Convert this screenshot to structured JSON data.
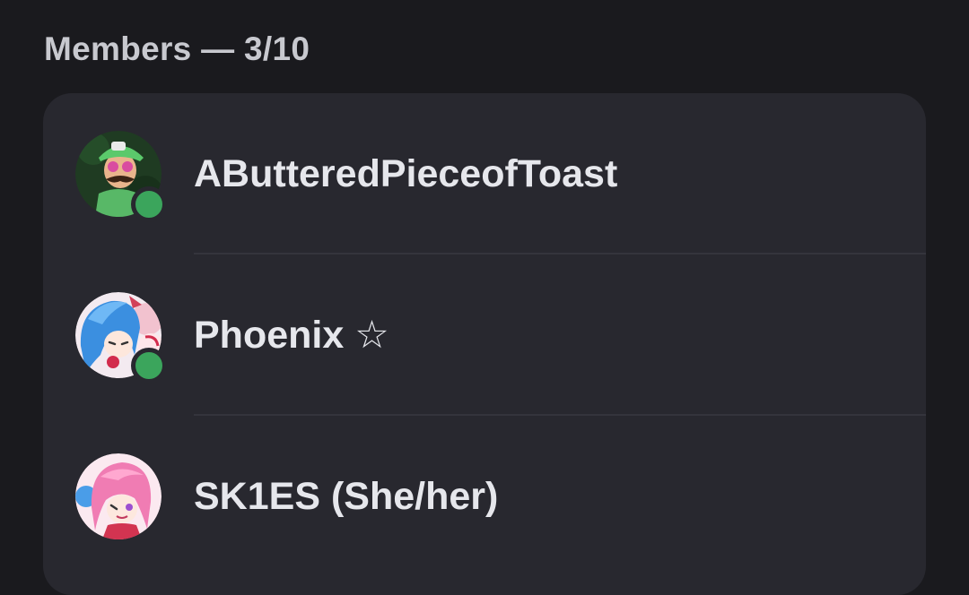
{
  "members_section": {
    "title": "Members — 3/10"
  },
  "members": [
    {
      "name": "AButteredPieceofToast",
      "status": "online",
      "avatar_icon": "green-cap-character-avatar-icon",
      "status_color": "#3ba55c"
    },
    {
      "name": "Phoenix ☆",
      "status": "online",
      "avatar_icon": "blue-hair-anime-avatar-icon",
      "status_color": "#3ba55c"
    },
    {
      "name": "SK1ES (She/her)",
      "status": "none",
      "avatar_icon": "pink-hair-anime-avatar-icon"
    }
  ],
  "colors": {
    "background": "#1a1a1e",
    "card": "#28282f",
    "online": "#3ba55c",
    "text": "#e6e7ec",
    "title_text": "#c8c9cf"
  }
}
